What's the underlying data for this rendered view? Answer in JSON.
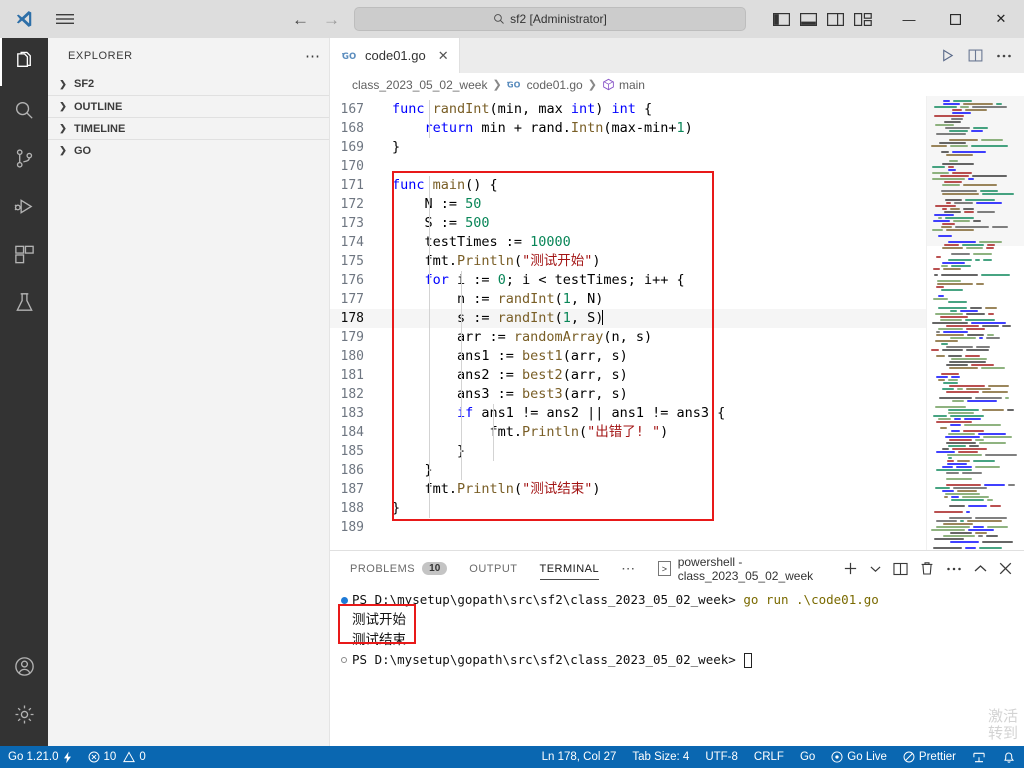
{
  "titlebar": {
    "search_value": "sf2 [Administrator]",
    "back_label": "←",
    "forward_label": "→",
    "layout_icons": [
      "toggle-primary-sidebar",
      "toggle-panel",
      "toggle-secondary-sidebar",
      "customize-layout"
    ],
    "minimize": "—",
    "maximize": "▢",
    "close": "✕"
  },
  "activitybar": {
    "items": [
      {
        "name": "explorer",
        "active": true
      },
      {
        "name": "search",
        "active": false
      },
      {
        "name": "source-control",
        "active": false
      },
      {
        "name": "run-debug",
        "active": false
      },
      {
        "name": "extensions",
        "active": false
      },
      {
        "name": "testing",
        "active": false
      }
    ],
    "bottom": [
      {
        "name": "account"
      },
      {
        "name": "manage-settings"
      }
    ]
  },
  "sidebar": {
    "title": "EXPLORER",
    "more_label": "⋯",
    "sections": [
      {
        "label": "SF2",
        "expanded": false
      },
      {
        "label": "OUTLINE",
        "expanded": false
      },
      {
        "label": "TIMELINE",
        "expanded": false
      },
      {
        "label": "GO",
        "expanded": false
      }
    ]
  },
  "editor": {
    "tab": {
      "label": "code01.go",
      "icon": "go-file-icon",
      "close": "✕"
    },
    "actions": [
      "run-button",
      "split-editor-button",
      "more-actions-button"
    ],
    "breadcrumb": [
      {
        "label": "class_2023_05_02_week",
        "icon": null
      },
      {
        "label": "code01.go",
        "icon": "go-file-icon"
      },
      {
        "label": "main",
        "icon": "symbol-method-icon"
      }
    ],
    "first_line_number": 167,
    "lines": [
      {
        "n": 167,
        "tokens": [
          {
            "t": "func ",
            "c": "kw"
          },
          {
            "t": "randInt",
            "c": "fn"
          },
          {
            "t": "(min, max ",
            "c": "pn"
          },
          {
            "t": "int",
            "c": "kw"
          },
          {
            "t": ") ",
            "c": "pn"
          },
          {
            "t": "int",
            "c": "kw"
          },
          {
            "t": " {",
            "c": "pn"
          }
        ]
      },
      {
        "n": 168,
        "tokens": [
          {
            "t": "    ",
            "c": "pn"
          },
          {
            "t": "return",
            "c": "kw"
          },
          {
            "t": " min + rand.",
            "c": "pn"
          },
          {
            "t": "Intn",
            "c": "fn"
          },
          {
            "t": "(max-min+",
            "c": "pn"
          },
          {
            "t": "1",
            "c": "num"
          },
          {
            "t": ")",
            "c": "pn"
          }
        ]
      },
      {
        "n": 169,
        "tokens": [
          {
            "t": "}",
            "c": "pn"
          }
        ]
      },
      {
        "n": 170,
        "tokens": []
      },
      {
        "n": 171,
        "tokens": [
          {
            "t": "func ",
            "c": "kw"
          },
          {
            "t": "main",
            "c": "fn"
          },
          {
            "t": "() {",
            "c": "pn"
          }
        ]
      },
      {
        "n": 172,
        "tokens": [
          {
            "t": "    N := ",
            "c": "pn"
          },
          {
            "t": "50",
            "c": "num"
          }
        ]
      },
      {
        "n": 173,
        "tokens": [
          {
            "t": "    S := ",
            "c": "pn"
          },
          {
            "t": "500",
            "c": "num"
          }
        ]
      },
      {
        "n": 174,
        "tokens": [
          {
            "t": "    testTimes := ",
            "c": "pn"
          },
          {
            "t": "10000",
            "c": "num"
          }
        ]
      },
      {
        "n": 175,
        "tokens": [
          {
            "t": "    fmt.",
            "c": "pn"
          },
          {
            "t": "Println",
            "c": "fn"
          },
          {
            "t": "(",
            "c": "pn"
          },
          {
            "t": "\"测试开始\"",
            "c": "str"
          },
          {
            "t": ")",
            "c": "pn"
          }
        ]
      },
      {
        "n": 176,
        "tokens": [
          {
            "t": "    ",
            "c": "pn"
          },
          {
            "t": "for",
            "c": "kw"
          },
          {
            "t": " i := ",
            "c": "pn"
          },
          {
            "t": "0",
            "c": "num"
          },
          {
            "t": "; i < testTimes; i++ {",
            "c": "pn"
          }
        ]
      },
      {
        "n": 177,
        "tokens": [
          {
            "t": "        n := ",
            "c": "pn"
          },
          {
            "t": "randInt",
            "c": "fn"
          },
          {
            "t": "(",
            "c": "pn"
          },
          {
            "t": "1",
            "c": "num"
          },
          {
            "t": ", N)",
            "c": "pn"
          }
        ]
      },
      {
        "n": 178,
        "tokens": [
          {
            "t": "        s := ",
            "c": "pn"
          },
          {
            "t": "randInt",
            "c": "fn"
          },
          {
            "t": "(",
            "c": "pn"
          },
          {
            "t": "1",
            "c": "num"
          },
          {
            "t": ", S)",
            "c": "pn"
          }
        ],
        "current": true
      },
      {
        "n": 179,
        "tokens": [
          {
            "t": "        arr := ",
            "c": "pn"
          },
          {
            "t": "randomArray",
            "c": "fn"
          },
          {
            "t": "(n, s)",
            "c": "pn"
          }
        ]
      },
      {
        "n": 180,
        "tokens": [
          {
            "t": "        ans1 := ",
            "c": "pn"
          },
          {
            "t": "best1",
            "c": "fn"
          },
          {
            "t": "(arr, s)",
            "c": "pn"
          }
        ]
      },
      {
        "n": 181,
        "tokens": [
          {
            "t": "        ans2 := ",
            "c": "pn"
          },
          {
            "t": "best2",
            "c": "fn"
          },
          {
            "t": "(arr, s)",
            "c": "pn"
          }
        ]
      },
      {
        "n": 182,
        "tokens": [
          {
            "t": "        ans3 := ",
            "c": "pn"
          },
          {
            "t": "best3",
            "c": "fn"
          },
          {
            "t": "(arr, s)",
            "c": "pn"
          }
        ]
      },
      {
        "n": 183,
        "tokens": [
          {
            "t": "        ",
            "c": "pn"
          },
          {
            "t": "if",
            "c": "kw"
          },
          {
            "t": " ans1 != ans2 || ans1 != ans3 {",
            "c": "pn"
          }
        ]
      },
      {
        "n": 184,
        "tokens": [
          {
            "t": "            fmt.",
            "c": "pn"
          },
          {
            "t": "Println",
            "c": "fn"
          },
          {
            "t": "(",
            "c": "pn"
          },
          {
            "t": "\"出错了! \"",
            "c": "str"
          },
          {
            "t": ")",
            "c": "pn"
          }
        ]
      },
      {
        "n": 185,
        "tokens": [
          {
            "t": "        }",
            "c": "pn"
          }
        ]
      },
      {
        "n": 186,
        "tokens": [
          {
            "t": "    }",
            "c": "pn"
          }
        ]
      },
      {
        "n": 187,
        "tokens": [
          {
            "t": "    fmt.",
            "c": "pn"
          },
          {
            "t": "Println",
            "c": "fn"
          },
          {
            "t": "(",
            "c": "pn"
          },
          {
            "t": "\"测试结束\"",
            "c": "str"
          },
          {
            "t": ")",
            "c": "pn"
          }
        ]
      },
      {
        "n": 188,
        "tokens": [
          {
            "t": "}",
            "c": "pn"
          }
        ]
      },
      {
        "n": 189,
        "tokens": []
      }
    ],
    "annotation_box": {
      "color": "#e81919",
      "from_line": 171,
      "to_line": 188
    }
  },
  "panel": {
    "tabs": [
      {
        "label": "PROBLEMS",
        "badge": "10",
        "active": false
      },
      {
        "label": "OUTPUT",
        "badge": null,
        "active": false
      },
      {
        "label": "TERMINAL",
        "badge": null,
        "active": true
      }
    ],
    "more_label": "⋯",
    "terminal_chip": {
      "icon": ">",
      "label": "powershell - class_2023_05_02_week"
    },
    "actions": [
      "new-terminal-button",
      "terminal-dropdown-button",
      "split-terminal-button",
      "kill-terminal-button",
      "panel-more-button",
      "maximize-panel-button",
      "close-panel-button"
    ],
    "terminal": {
      "prompt_1": "PS D:\\mysetup\\gopath\\src\\sf2\\class_2023_05_02_week>",
      "command_1": " go run .\\code01.go",
      "output_1": "测试开始",
      "output_2": "测试结束",
      "prompt_2": "PS D:\\mysetup\\gopath\\src\\sf2\\class_2023_05_02_week>",
      "annotation_color": "#e81919"
    }
  },
  "statusbar": {
    "left": [
      {
        "label": "Go 1.21.0",
        "icon": "go-env-icon"
      },
      {
        "label": "10",
        "icon": "error-icon",
        "label2": "0",
        "icon2": "warning-icon"
      }
    ],
    "go_version": "Go 1.21.0",
    "errors": "10",
    "warnings": "0",
    "right": [
      {
        "name": "cursor-position",
        "label": "Ln 178, Col 27"
      },
      {
        "name": "tab-size",
        "label": "Tab Size: 4"
      },
      {
        "name": "encoding",
        "label": "UTF-8"
      },
      {
        "name": "eol",
        "label": "CRLF"
      },
      {
        "name": "language-mode",
        "label": "Go"
      },
      {
        "name": "go-live",
        "label": "Go Live"
      },
      {
        "name": "prettier",
        "label": "Prettier"
      }
    ],
    "background": "#0a67b1"
  },
  "watermark": {
    "line1": "激活",
    "line2": "转到"
  }
}
